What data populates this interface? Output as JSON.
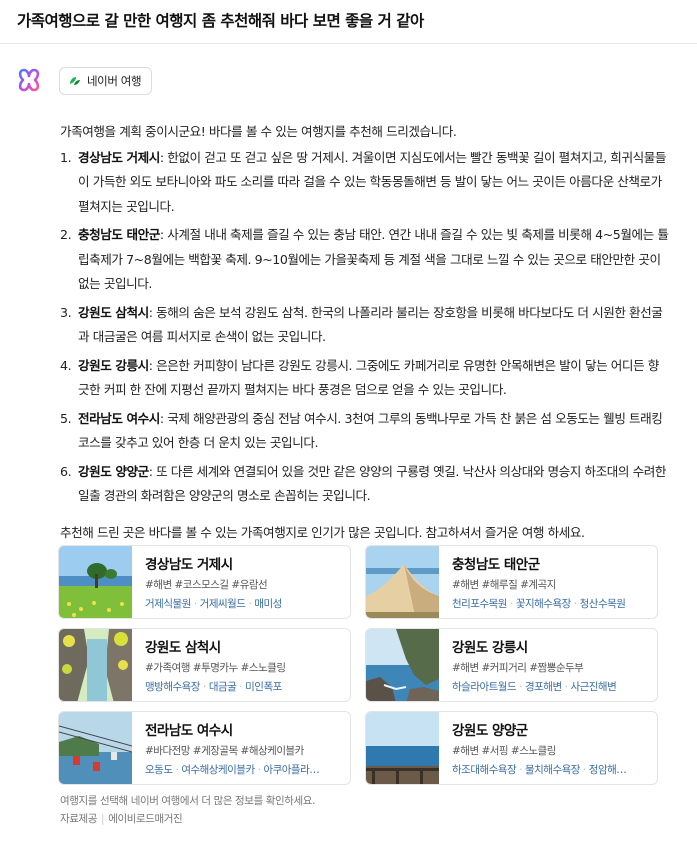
{
  "query": "가족여행으로 갈 만한 여행지 좀 추천해줘 바다 보면 좋을 거 같아",
  "source_chip": {
    "icon": "naver-travel-icon",
    "label": "네이버 여행"
  },
  "answer": {
    "intro": "가족여행을 계획 중이시군요! 바다를 볼 수 있는 여행지를 추천해 드리겠습니다.",
    "items": [
      {
        "num": "1.",
        "name": "경상남도 거제시",
        "desc": ": 한없이 걷고 또 걷고 싶은 땅 거제시. 겨울이면 지심도에서는 빨간 동백꽃 길이 펼쳐지고, 희귀식물들이 가득한 외도 보타니아와 파도 소리를 따라 걸을 수 있는 학동몽돌해변 등 발이 닿는 어느 곳이든 아름다운 산책로가 펼쳐지는 곳입니다."
      },
      {
        "num": "2.",
        "name": "충청남도 태안군",
        "desc": ": 사계절 내내 축제를 즐길 수 있는 충남 태안. 연간 내내 즐길 수 있는 빛 축제를 비롯해 4~5월에는 튤립축제가 7~8월에는 백합꽃 축제. 9~10월에는 가을꽃축제 등 계절 색을 그대로 느낄 수 있는 곳으로 태안만한 곳이 없는 곳입니다."
      },
      {
        "num": "3.",
        "name": "강원도 삼척시",
        "desc": ": 동해의 숨은 보석 강원도 삼척. 한국의 나폴리라 불리는 장호항을 비롯해 바다보다도 더 시원한 환선굴과 대금굴은 여름 피서지로 손색이 없는 곳입니다."
      },
      {
        "num": "4.",
        "name": "강원도 강릉시",
        "desc": ": 은은한 커피향이 남다른 강원도 강릉시. 그중에도 카페거리로 유명한 안목해변은 발이 닿는 어디든 향긋한 커피 한 잔에 지평선 끝까지 펼쳐지는 바다 풍경은 덤으로 얻을 수 있는 곳입니다."
      },
      {
        "num": "5.",
        "name": "전라남도 여수시",
        "desc": ": 국제 해양관광의 중심 전남 여수시. 3천여 그루의 동백나무로 가득 찬 붉은 섬 오동도는 웰빙 트래킹 코스를 갖추고 있어 한층 더 운치 있는 곳입니다."
      },
      {
        "num": "6.",
        "name": "강원도 양양군",
        "desc": ": 또 다른 세계와 연결되어 있을 것만 같은 양양의 구룡령 옛길. 낙산사 의상대와 명승지 하조대의 수려한 일출 경관의 화려함은 양양군의 명소로 손꼽히는 곳입니다."
      }
    ],
    "closing": "추천해 드린 곳은 바다를 볼 수 있는 가족여행지로 인기가 많은 곳입니다. 참고하셔서 즐거운 여행 하세요."
  },
  "cards": [
    {
      "title": "경상남도 거제시",
      "tags": "#해변 #코스모스길 #유람선",
      "links": [
        "거제식물원",
        "거제씨월드",
        "매미성"
      ]
    },
    {
      "title": "충청남도 태안군",
      "tags": "#해변 #해루질 #계곡지",
      "links": [
        "천리포수목원",
        "꽃지해수욕장",
        "청산수목원"
      ]
    },
    {
      "title": "강원도 삼척시",
      "tags": "#가족여행 #투명카누 #스노클링",
      "links": [
        "맹방해수욕장",
        "대금굴",
        "미인폭포"
      ]
    },
    {
      "title": "강원도 강릉시",
      "tags": "#해변 #커피거리 #짬뽕순두부",
      "links": [
        "하슬라아트월드",
        "경포해변",
        "사근진해변"
      ]
    },
    {
      "title": "전라남도 여수시",
      "tags": "#바다전망 #게장골목 #해상케이블카",
      "links": [
        "오동도",
        "여수해상케이블카",
        "아쿠아플라…"
      ]
    },
    {
      "title": "강원도 양양군",
      "tags": "#해변 #서핑 #스노클링",
      "links": [
        "하조대해수욕장",
        "물치해수욕장",
        "정암해…"
      ]
    }
  ],
  "footer": {
    "note": "여행지를 선택해 네이버 여행에서 더 많은 정보를 확인하세요.",
    "credit_label": "자료제공",
    "credit_source": "에이비로드매거진"
  }
}
